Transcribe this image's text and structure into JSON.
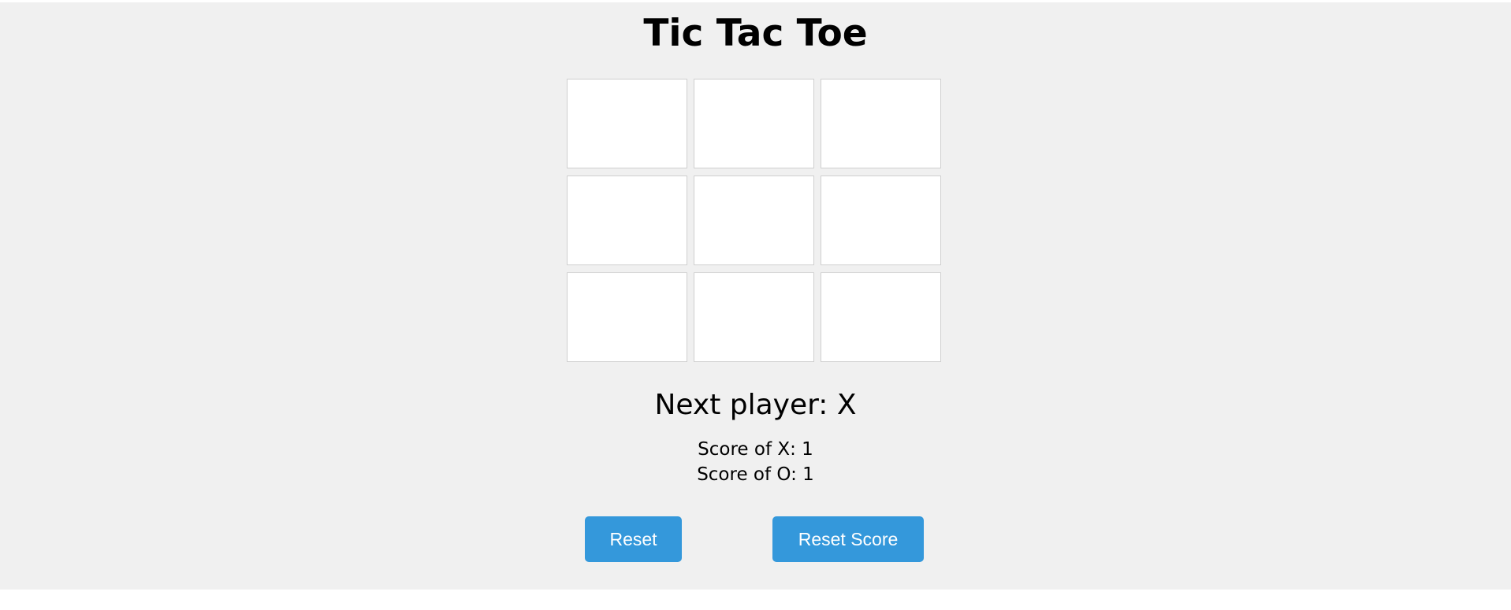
{
  "app": {
    "title": "Tic Tac Toe"
  },
  "board": {
    "cells": [
      "",
      "",
      "",
      "",
      "",
      "",
      "",
      "",
      ""
    ]
  },
  "status": {
    "next_player_text": "Next player: X"
  },
  "scores": {
    "x_text": "Score of X: 1",
    "o_text": "Score of O: 1"
  },
  "buttons": {
    "reset_label": "Reset",
    "reset_score_label": "Reset Score"
  },
  "colors": {
    "background": "#f0f0f0",
    "button": "#3498db",
    "cell": "#ffffff"
  }
}
